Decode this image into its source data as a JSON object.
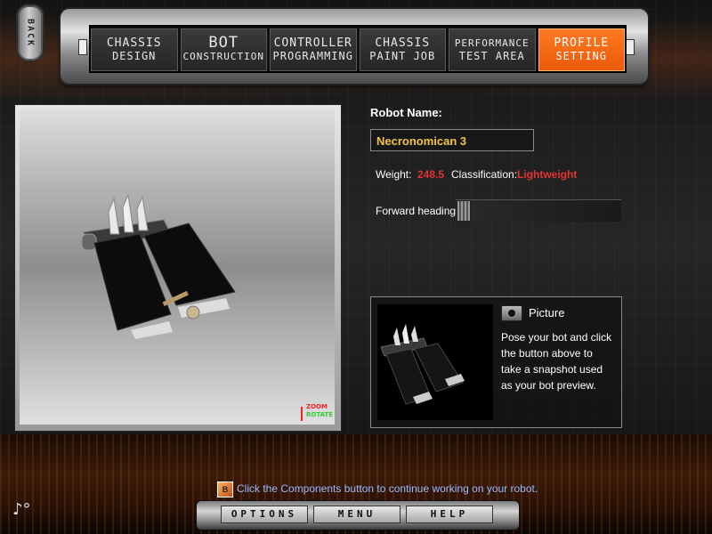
{
  "back_label": "BACK",
  "nav": [
    {
      "line1": "CHASSIS",
      "line2": "DESIGN",
      "style": "",
      "active": false
    },
    {
      "line1": "BOT",
      "line2": "CONSTRUCTION",
      "style": "big",
      "active": false
    },
    {
      "line1": "CONTROLLER",
      "line2": "PROGRAMMING",
      "style": "",
      "active": false
    },
    {
      "line1": "CHASSIS",
      "line2": "PAINT JOB",
      "style": "",
      "active": false
    },
    {
      "line1": "PERFORMANCE",
      "line2": "TEST AREA",
      "style": "small",
      "active": false
    },
    {
      "line1": "PROFILE",
      "line2": "SETTING",
      "style": "",
      "active": true
    }
  ],
  "viewport": {
    "zoom_label": "ZOOM",
    "rotate_label": "ROTATE"
  },
  "profile": {
    "robot_name_label": "Robot Name:",
    "robot_name": "Necronomican 3",
    "weight_label": "Weight:",
    "weight_value": "248.5",
    "classification_label": "Classification:",
    "classification_value": "Lightweight",
    "heading_label": "Forward heading:",
    "heading_value": 0
  },
  "picture": {
    "title": "Picture",
    "description": "Pose your bot and click the button above to take a snapshot used as your bot preview."
  },
  "status": "Click the Components button to continue working on your robot.",
  "bottom": {
    "options": "OPTIONS",
    "menu": "MENU",
    "help": "HELP"
  },
  "colors": {
    "accent": "#ff7a20",
    "name_text": "#f2c542",
    "warning": "#e23232",
    "status_text": "#9ab8ff"
  }
}
